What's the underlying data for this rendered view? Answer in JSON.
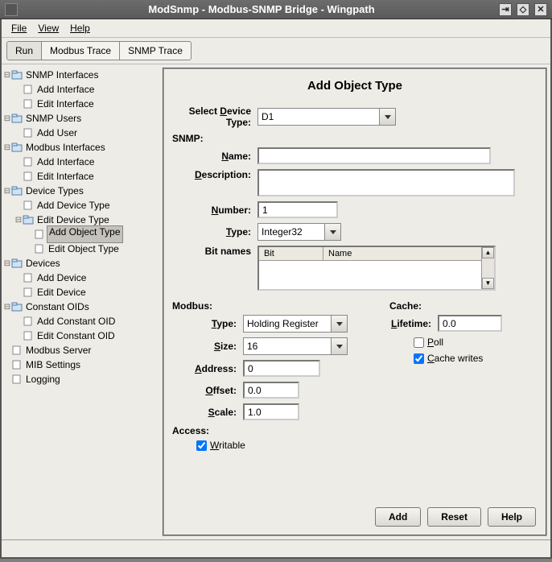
{
  "title": "ModSnmp - Modbus-SNMP Bridge - Wingpath",
  "menu": {
    "file": "File",
    "view": "View",
    "help": "Help"
  },
  "tabs": {
    "run": "Run",
    "modbus": "Modbus Trace",
    "snmp": "SNMP Trace"
  },
  "tree": {
    "snmp_if": "SNMP Interfaces",
    "add_if": "Add Interface",
    "edit_if": "Edit Interface",
    "snmp_users": "SNMP Users",
    "add_user": "Add User",
    "mb_if": "Modbus Interfaces",
    "dev_types": "Device Types",
    "add_dt": "Add Device Type",
    "edit_dt": "Edit Device Type",
    "add_ot": "Add Object Type",
    "edit_ot": "Edit Object Type",
    "devices": "Devices",
    "add_dev": "Add Device",
    "edit_dev": "Edit Device",
    "const_oids": "Constant OIDs",
    "add_co": "Add Constant OID",
    "edit_co": "Edit Constant OID",
    "mb_server": "Modbus Server",
    "mib": "MIB Settings",
    "logging": "Logging"
  },
  "form": {
    "title": "Add Object Type",
    "sel_device_lbl": "Select Device Type:",
    "device": "D1",
    "snmp": "SNMP:",
    "name_lbl": "Name:",
    "name": "",
    "desc_lbl": "Description:",
    "desc": "",
    "number_lbl": "Number:",
    "number": "1",
    "type_lbl": "Type:",
    "type": "Integer32",
    "bitnames_lbl": "Bit names",
    "bh_bit": "Bit",
    "bh_name": "Name",
    "modbus": "Modbus:",
    "mb_type": "Holding Register",
    "size_lbl": "Size:",
    "size": "16",
    "addr_lbl": "Address:",
    "addr": "0",
    "offset_lbl": "Offset:",
    "offset": "0.0",
    "scale_lbl": "Scale:",
    "scale": "1.0",
    "access": "Access:",
    "writable": "Writable",
    "cache": "Cache:",
    "lifetime_lbl": "Lifetime:",
    "lifetime": "0.0",
    "poll": "Poll",
    "cache_writes": "Cache writes"
  },
  "buttons": {
    "add": "Add",
    "reset": "Reset",
    "help": "Help"
  }
}
